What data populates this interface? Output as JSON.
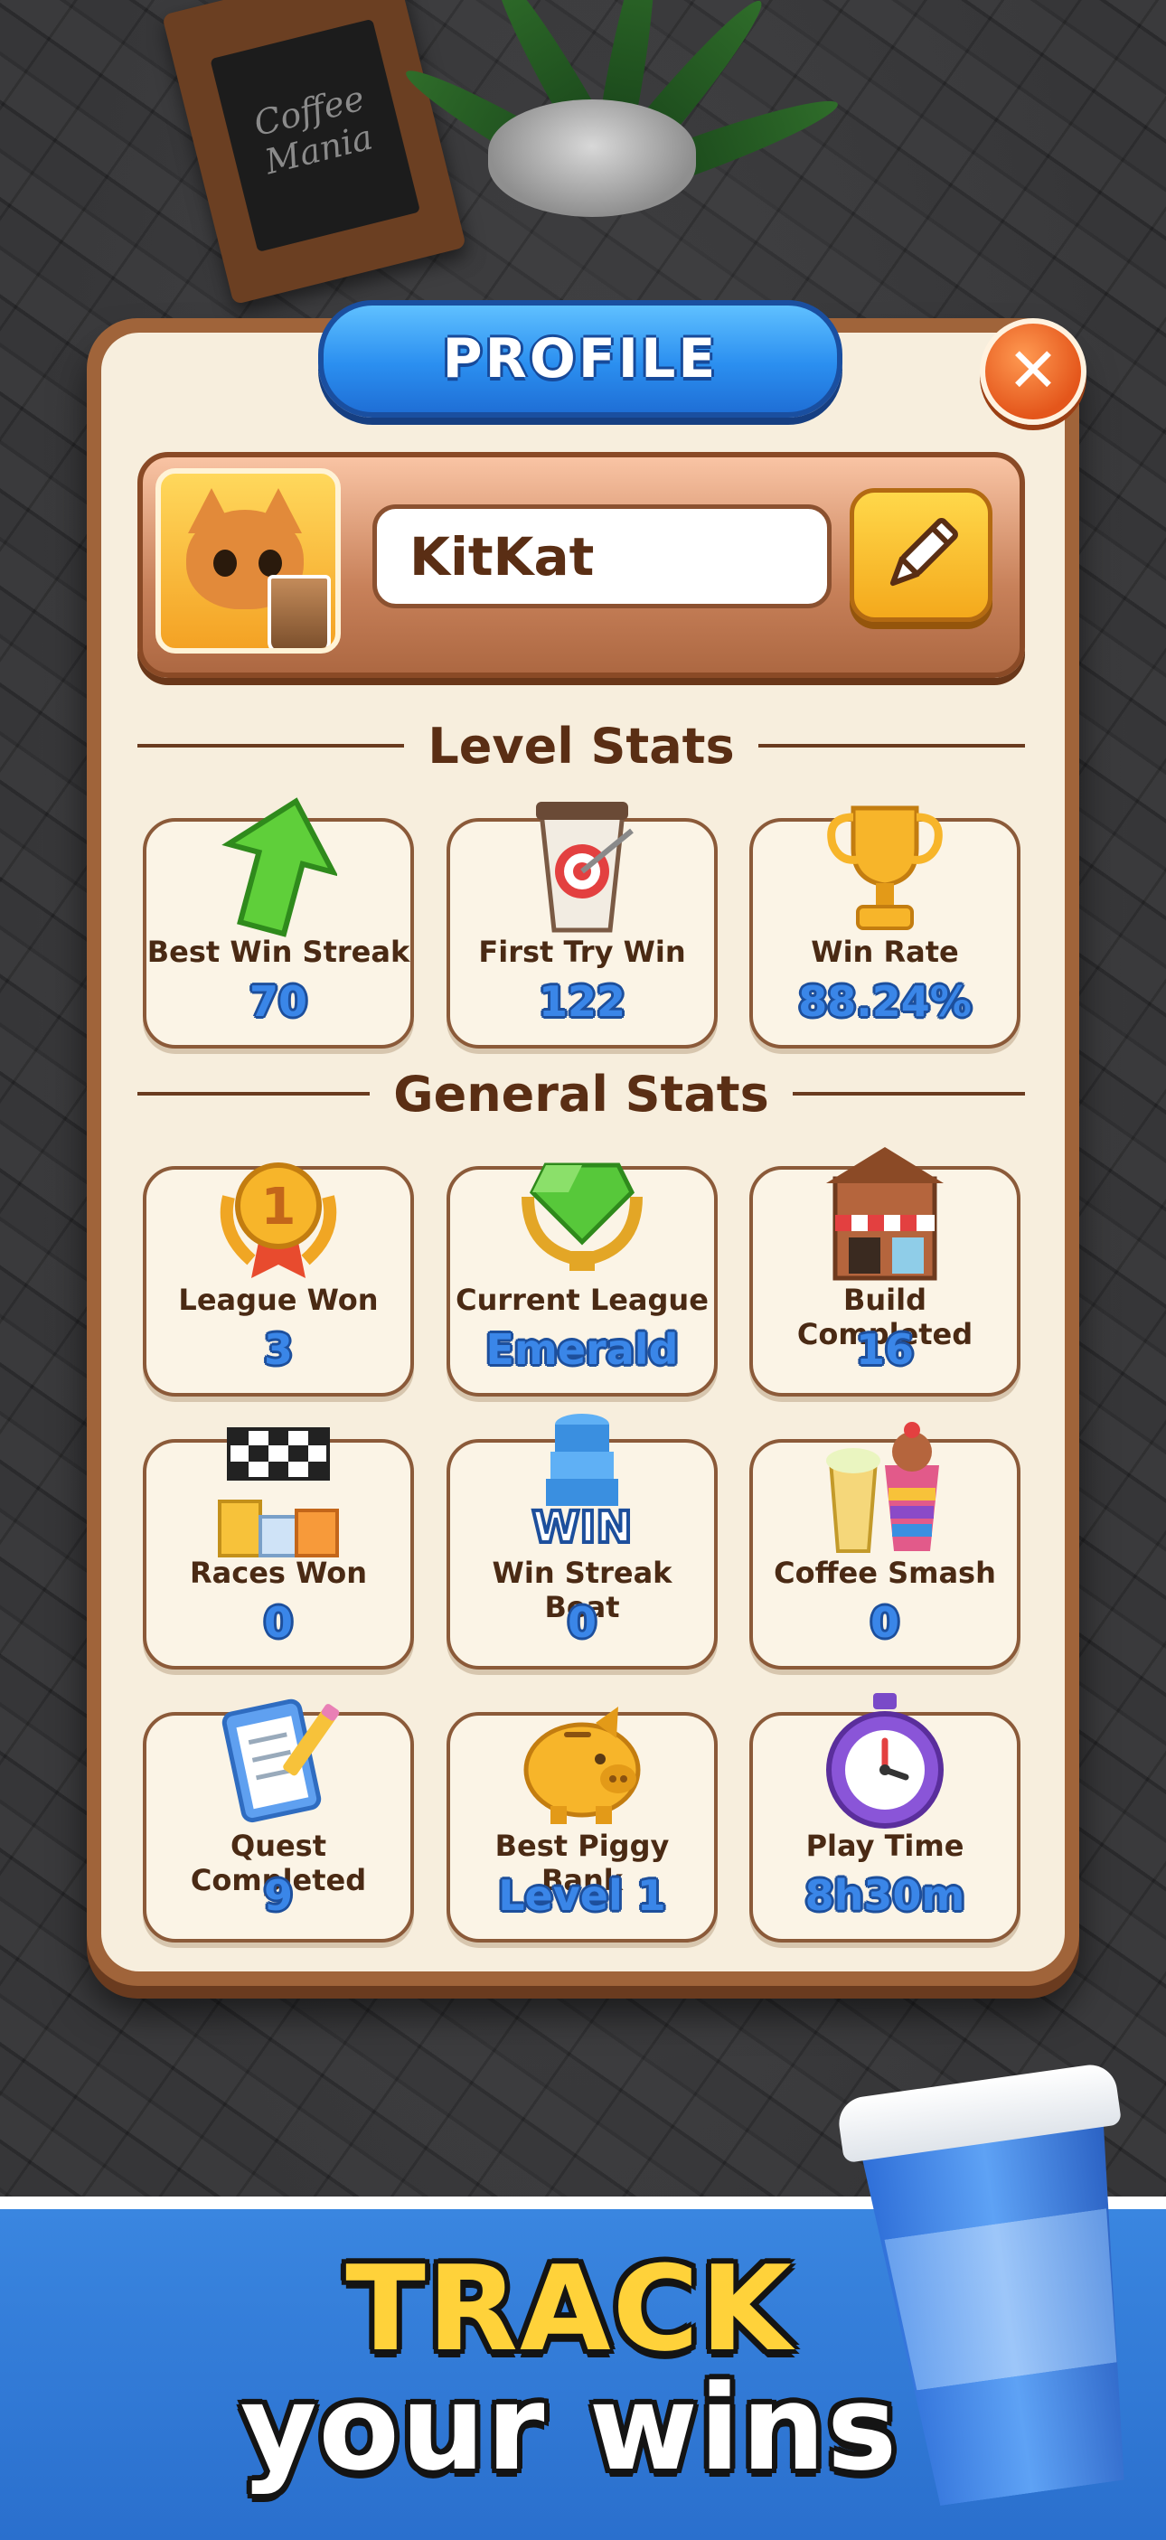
{
  "header": {
    "title": "PROFILE",
    "close_symbol": "✕"
  },
  "background": {
    "sign_text": "Coffee Mania"
  },
  "profile": {
    "username": "KitKat"
  },
  "sections": {
    "level_title": "Level Stats",
    "general_title": "General Stats"
  },
  "level_stats": [
    {
      "label": "Best Win Streak",
      "value": "70",
      "icon": "green-arrow-icon"
    },
    {
      "label": "First Try Win",
      "value": "122",
      "icon": "target-cup-icon"
    },
    {
      "label": "Win Rate",
      "value": "88.24%",
      "icon": "trophy-icon"
    }
  ],
  "general_stats": [
    {
      "label": "League Won",
      "value": "3",
      "icon": "medal-icon"
    },
    {
      "label": "Current League",
      "value": "Emerald",
      "icon": "emerald-trophy-icon"
    },
    {
      "label": "Build Completed",
      "value": "16",
      "icon": "shop-building-icon"
    },
    {
      "label": "Races Won",
      "value": "0",
      "icon": "race-podium-icon"
    },
    {
      "label": "Win Streak Beat",
      "value": "0",
      "icon": "win-stack-icon"
    },
    {
      "label": "Coffee Smash",
      "value": "0",
      "icon": "drinks-icon"
    },
    {
      "label": "Quest Completed",
      "value": "9",
      "icon": "clipboard-icon"
    },
    {
      "label": "Best Piggy Bank",
      "value": "Level 1",
      "icon": "piggy-bank-icon"
    },
    {
      "label": "Play Time",
      "value": "8h30m",
      "icon": "stopwatch-icon"
    }
  ],
  "banner": {
    "line1": "TRACK",
    "line2": "your wins"
  },
  "colors": {
    "accent_blue": "#2b8ff0",
    "panel_brown": "#a0643a",
    "panel_cream": "#f7eedd",
    "banner_yellow": "#ffd23a"
  }
}
